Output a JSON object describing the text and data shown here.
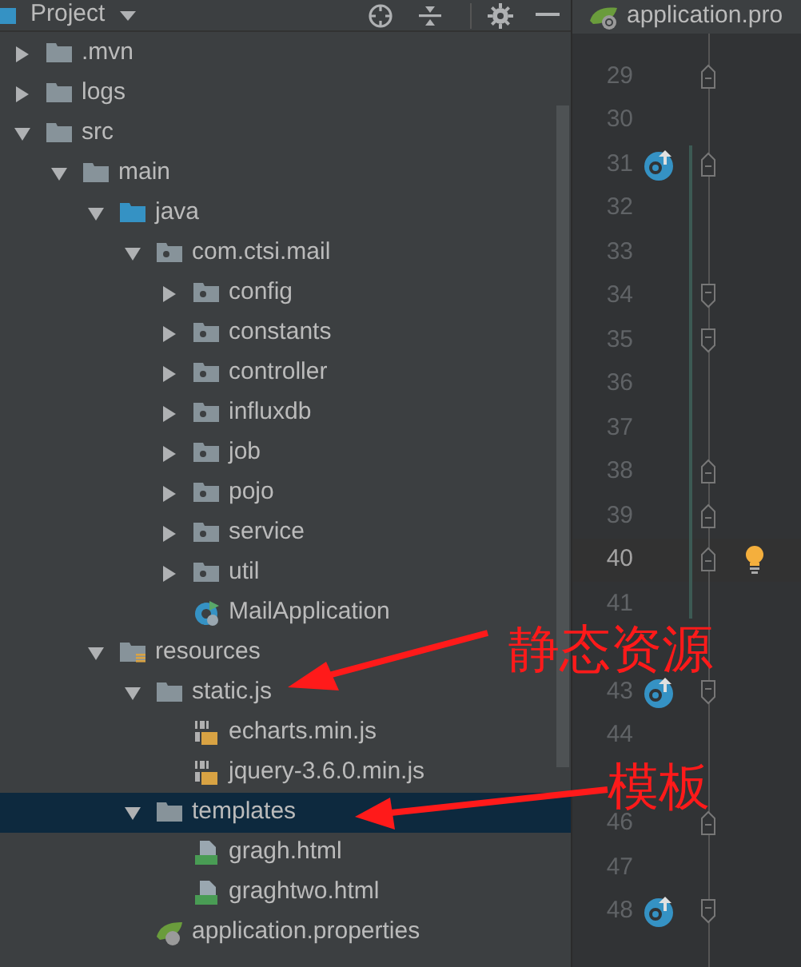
{
  "project_panel": {
    "title": "Project"
  },
  "editor_tab": {
    "title": "application.pro"
  },
  "tree": [
    {
      "label": ".mvn",
      "kind": "folder",
      "expanded": false,
      "selected": false
    },
    {
      "label": "logs",
      "kind": "folder",
      "expanded": false,
      "selected": false
    },
    {
      "label": "src",
      "kind": "folder",
      "expanded": true,
      "selected": false,
      "children": [
        {
          "label": "main",
          "kind": "folder",
          "expanded": true,
          "selected": false,
          "children": [
            {
              "label": "java",
              "kind": "source-folder",
              "expanded": true,
              "selected": false,
              "children": [
                {
                  "label": "com.ctsi.mail",
                  "kind": "package",
                  "expanded": true,
                  "selected": false,
                  "children": [
                    {
                      "label": "config",
                      "kind": "package",
                      "expanded": false,
                      "selected": false
                    },
                    {
                      "label": "constants",
                      "kind": "package",
                      "expanded": false,
                      "selected": false
                    },
                    {
                      "label": "controller",
                      "kind": "package",
                      "expanded": false,
                      "selected": false
                    },
                    {
                      "label": "influxdb",
                      "kind": "package",
                      "expanded": false,
                      "selected": false
                    },
                    {
                      "label": "job",
                      "kind": "package",
                      "expanded": false,
                      "selected": false
                    },
                    {
                      "label": "pojo",
                      "kind": "package",
                      "expanded": false,
                      "selected": false
                    },
                    {
                      "label": "service",
                      "kind": "package",
                      "expanded": false,
                      "selected": false
                    },
                    {
                      "label": "util",
                      "kind": "package",
                      "expanded": false,
                      "selected": false
                    },
                    {
                      "label": "MailApplication",
                      "kind": "spring-class",
                      "selected": false
                    }
                  ]
                }
              ]
            },
            {
              "label": "resources",
              "kind": "resource-folder",
              "expanded": true,
              "selected": false,
              "children": [
                {
                  "label": "static.js",
                  "kind": "folder",
                  "expanded": true,
                  "selected": false,
                  "children": [
                    {
                      "label": "echarts.min.js",
                      "kind": "js",
                      "selected": false
                    },
                    {
                      "label": "jquery-3.6.0.min.js",
                      "kind": "js",
                      "selected": false
                    }
                  ]
                },
                {
                  "label": "templates",
                  "kind": "folder",
                  "expanded": true,
                  "selected": true,
                  "children": [
                    {
                      "label": "gragh.html",
                      "kind": "html",
                      "selected": false
                    },
                    {
                      "label": "graghtwo.html",
                      "kind": "html",
                      "selected": false
                    }
                  ]
                },
                {
                  "label": "application.properties",
                  "kind": "properties",
                  "selected": false
                }
              ]
            }
          ]
        }
      ]
    }
  ],
  "gutter": [
    {
      "number": "29",
      "run": false,
      "fold_start": true,
      "fold_end": false,
      "current": false
    },
    {
      "number": "30",
      "run": false,
      "current": false
    },
    {
      "number": "31",
      "run": true,
      "fold_start": true,
      "fold_end": false,
      "current": false
    },
    {
      "number": "32",
      "run": false,
      "current": false
    },
    {
      "number": "33",
      "run": false,
      "current": false
    },
    {
      "number": "34",
      "run": false,
      "fold_start": false,
      "fold_end": true,
      "current": false
    },
    {
      "number": "35",
      "run": false,
      "fold_start": false,
      "fold_end": true,
      "current": false
    },
    {
      "number": "36",
      "run": false,
      "current": false
    },
    {
      "number": "37",
      "run": false,
      "current": false
    },
    {
      "number": "38",
      "run": false,
      "fold_start": true,
      "fold_end": false,
      "current": false
    },
    {
      "number": "39",
      "run": false,
      "fold_start": true,
      "fold_end": false,
      "current": false
    },
    {
      "number": "40",
      "run": false,
      "fold_start": true,
      "fold_end": false,
      "current": true,
      "bulb": true
    },
    {
      "number": "41",
      "run": false,
      "current": false
    },
    {
      "number": "43",
      "run": true,
      "fold_start": false,
      "fold_end": true,
      "current": false
    },
    {
      "number": "44",
      "run": false,
      "current": false
    },
    {
      "number": "46",
      "run": false,
      "fold_start": true,
      "fold_end": false,
      "current": false
    },
    {
      "number": "47",
      "run": false,
      "current": false
    },
    {
      "number": "48",
      "run": true,
      "fold_start": false,
      "fold_end": true,
      "current": false
    }
  ],
  "annotations": [
    {
      "text": "静态资源"
    },
    {
      "text": "模板"
    }
  ]
}
